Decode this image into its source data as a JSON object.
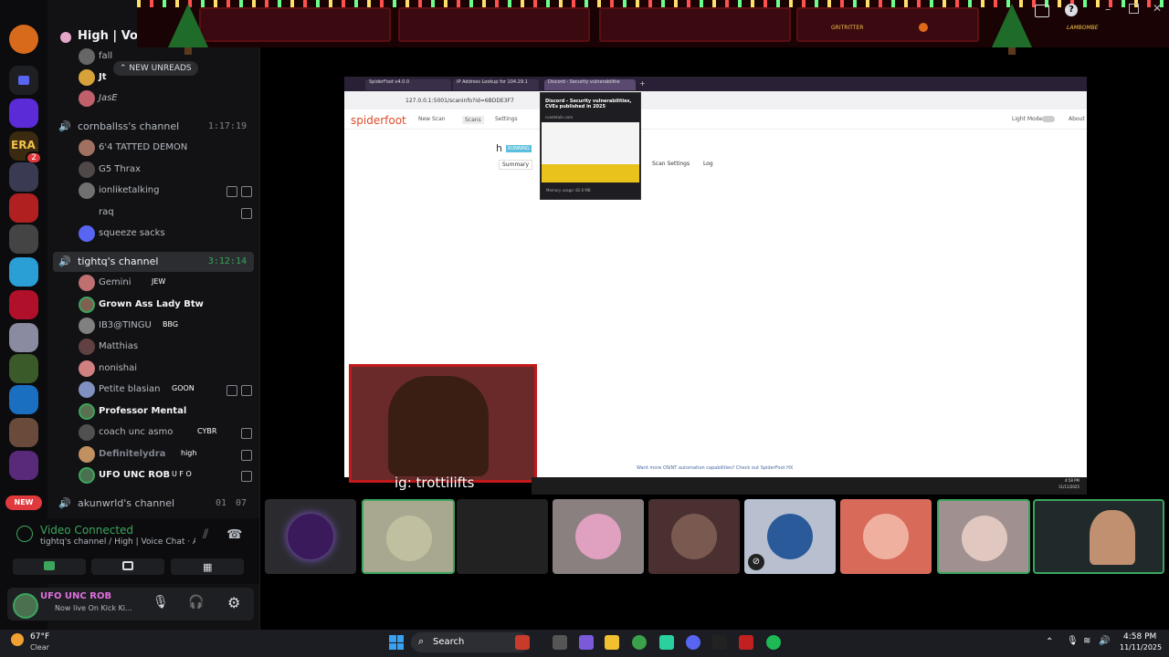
{
  "server": {
    "name": "High | Voice Chat"
  },
  "new_unreads": "NEW UNREADS",
  "new_label": "NEW",
  "badge_count": "2",
  "top_users": [
    "fall",
    "Jt",
    "JasE"
  ],
  "channels": [
    {
      "name": "cornballss's channel",
      "time": "1:17:19",
      "users": [
        "6'4 TATTED DEMON",
        "G5 Thrax",
        "ionliketalking",
        "raq",
        "squeeze sacks"
      ]
    },
    {
      "name": "tightq's channel",
      "time": "3:12:14",
      "users": [
        {
          "name": "Gemini",
          "tag": "JEW"
        },
        {
          "name": "Grown Ass Lady Btw",
          "tag": ""
        },
        {
          "name": "IB3@TINGU",
          "tag": "BBG"
        },
        {
          "name": "Matthias",
          "tag": ""
        },
        {
          "name": "nonishai",
          "tag": ""
        },
        {
          "name": "Petite blasian",
          "tag": "GOON"
        },
        {
          "name": "Professor Mental",
          "tag": ""
        },
        {
          "name": "coach unc asmo",
          "tag": "CYBR"
        },
        {
          "name": "Definitelydra",
          "tag": "high"
        },
        {
          "name": "UFO UNC ROB",
          "tag": "U F O"
        }
      ]
    },
    {
      "name": "akunwrld's channel",
      "count_a": "01",
      "count_b": "07"
    }
  ],
  "voice": {
    "status": "Video Connected",
    "detail": "tightq's channel / High | Voice Chat · Activ..."
  },
  "me": {
    "name": "UFO UNC ROB",
    "status": "Now live On Kick Ki..."
  },
  "banner": {
    "left_label": "GRITRITTER",
    "right_label": "LAMBOMBE"
  },
  "stream": {
    "tabs": [
      "SpiderFoot v4.0.0",
      "IP Address Lookup for 104.29.1",
      "Discord - Security vulnerabilitie"
    ],
    "url": "127.0.0.1:5001/scaninfo?id=6BDDE3F7",
    "sf_nav": [
      "New Scan",
      "Scans",
      "Settings"
    ],
    "sf_brand": "spiderfoot",
    "light_mode": "Light Mode",
    "about": "About",
    "scan_name": "h",
    "scan_status": "RUNNING",
    "scan_tabs": [
      "Summary",
      "Scan Settings",
      "Log"
    ],
    "tooltip_title": "Discord - Security vulnerabilities, CVEs published in 2025",
    "tooltip_url": "cvedetails.com",
    "tooltip_mem": "Memory usage: 82.6 MB",
    "footer_note": "Want more OSINT automation capabilities? Check out SpiderFoot HX",
    "caption": "ig: trottilifts",
    "time": "4:58 PM",
    "date": "11/11/2025"
  },
  "taskbar": {
    "temp": "67°F",
    "weather": "Clear",
    "search": "Search",
    "time": "4:58 PM",
    "date": "11/11/2025"
  }
}
